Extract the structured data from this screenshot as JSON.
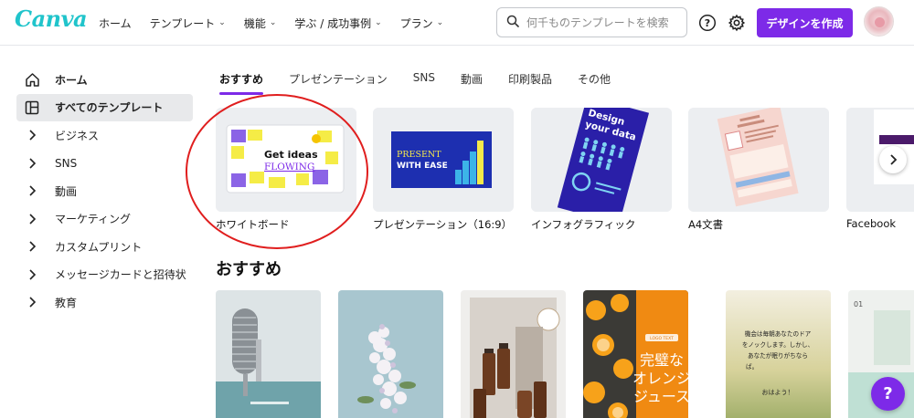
{
  "header": {
    "logo": "Canva",
    "nav": [
      {
        "label": "ホーム",
        "has_dropdown": false
      },
      {
        "label": "テンプレート",
        "has_dropdown": true
      },
      {
        "label": "機能",
        "has_dropdown": true
      },
      {
        "label": "学ぶ / 成功事例",
        "has_dropdown": true
      },
      {
        "label": "プラン",
        "has_dropdown": true
      }
    ],
    "search_placeholder": "何千ものテンプレートを検索",
    "create_button": "デザインを作成"
  },
  "sidebar": {
    "items": [
      {
        "label": "ホーム",
        "icon": "home-icon"
      },
      {
        "label": "すべてのテンプレート",
        "icon": "layout-icon",
        "active": true
      },
      {
        "label": "ビジネス",
        "icon": "chevron-right-icon"
      },
      {
        "label": "SNS",
        "icon": "chevron-right-icon"
      },
      {
        "label": "動画",
        "icon": "chevron-right-icon"
      },
      {
        "label": "マーケティング",
        "icon": "chevron-right-icon"
      },
      {
        "label": "カスタムプリント",
        "icon": "chevron-right-icon"
      },
      {
        "label": "メッセージカードと招待状",
        "icon": "chevron-right-icon"
      },
      {
        "label": "教育",
        "icon": "chevron-right-icon"
      }
    ]
  },
  "tabs": [
    {
      "label": "おすすめ",
      "active": true
    },
    {
      "label": "プレゼンテーション"
    },
    {
      "label": "SNS"
    },
    {
      "label": "動画"
    },
    {
      "label": "印刷製品"
    },
    {
      "label": "その他"
    }
  ],
  "categories": [
    {
      "label": "ホワイトボード",
      "thumb": {
        "line1": "Get ideas",
        "line2": "FLOWING"
      }
    },
    {
      "label": "プレゼンテーション（16:9）",
      "thumb": {
        "line1": "PRESENT",
        "line2": "WITH EASE"
      }
    },
    {
      "label": "インフォグラフィック",
      "thumb": {
        "line1": "Design",
        "line2": "your data"
      }
    },
    {
      "label": "A4文書"
    },
    {
      "label": "Facebook"
    }
  ],
  "section": {
    "title": "おすすめ"
  },
  "templates": [
    {
      "name": "microphone"
    },
    {
      "name": "flower"
    },
    {
      "name": "cosmetics"
    },
    {
      "name": "orange-juice",
      "text_top": "LOGO TEXT",
      "text": [
        "完璧な",
        "オレンジ",
        "ジュース"
      ]
    },
    {
      "name": "quote",
      "text": [
        "機会は毎朝あなたのドア",
        "をノックします。しかし、",
        "あなたが眠りがちなら",
        "ば。"
      ],
      "greeting": "おはよう！"
    },
    {
      "name": "partial",
      "number": "01"
    }
  ],
  "help_fab": "?",
  "colors": {
    "brand": "#7d2ae8",
    "logo": "#20c4cb",
    "annotation": "#e01e1e"
  }
}
